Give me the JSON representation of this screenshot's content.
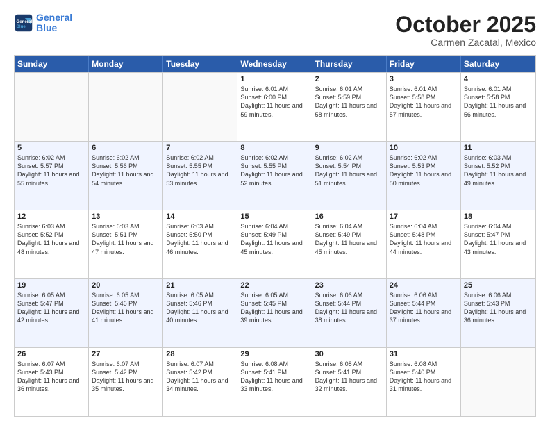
{
  "logo": {
    "line1": "General",
    "line2": "Blue"
  },
  "title": "October 2025",
  "subtitle": "Carmen Zacatal, Mexico",
  "days_of_week": [
    "Sunday",
    "Monday",
    "Tuesday",
    "Wednesday",
    "Thursday",
    "Friday",
    "Saturday"
  ],
  "weeks": [
    [
      {
        "day": "",
        "sunrise": "",
        "sunset": "",
        "daylight": "",
        "empty": true
      },
      {
        "day": "",
        "sunrise": "",
        "sunset": "",
        "daylight": "",
        "empty": true
      },
      {
        "day": "",
        "sunrise": "",
        "sunset": "",
        "daylight": "",
        "empty": true
      },
      {
        "day": "1",
        "sunrise": "Sunrise: 6:01 AM",
        "sunset": "Sunset: 6:00 PM",
        "daylight": "Daylight: 11 hours and 59 minutes."
      },
      {
        "day": "2",
        "sunrise": "Sunrise: 6:01 AM",
        "sunset": "Sunset: 5:59 PM",
        "daylight": "Daylight: 11 hours and 58 minutes."
      },
      {
        "day": "3",
        "sunrise": "Sunrise: 6:01 AM",
        "sunset": "Sunset: 5:58 PM",
        "daylight": "Daylight: 11 hours and 57 minutes."
      },
      {
        "day": "4",
        "sunrise": "Sunrise: 6:01 AM",
        "sunset": "Sunset: 5:58 PM",
        "daylight": "Daylight: 11 hours and 56 minutes."
      }
    ],
    [
      {
        "day": "5",
        "sunrise": "Sunrise: 6:02 AM",
        "sunset": "Sunset: 5:57 PM",
        "daylight": "Daylight: 11 hours and 55 minutes."
      },
      {
        "day": "6",
        "sunrise": "Sunrise: 6:02 AM",
        "sunset": "Sunset: 5:56 PM",
        "daylight": "Daylight: 11 hours and 54 minutes."
      },
      {
        "day": "7",
        "sunrise": "Sunrise: 6:02 AM",
        "sunset": "Sunset: 5:55 PM",
        "daylight": "Daylight: 11 hours and 53 minutes."
      },
      {
        "day": "8",
        "sunrise": "Sunrise: 6:02 AM",
        "sunset": "Sunset: 5:55 PM",
        "daylight": "Daylight: 11 hours and 52 minutes."
      },
      {
        "day": "9",
        "sunrise": "Sunrise: 6:02 AM",
        "sunset": "Sunset: 5:54 PM",
        "daylight": "Daylight: 11 hours and 51 minutes."
      },
      {
        "day": "10",
        "sunrise": "Sunrise: 6:02 AM",
        "sunset": "Sunset: 5:53 PM",
        "daylight": "Daylight: 11 hours and 50 minutes."
      },
      {
        "day": "11",
        "sunrise": "Sunrise: 6:03 AM",
        "sunset": "Sunset: 5:52 PM",
        "daylight": "Daylight: 11 hours and 49 minutes."
      }
    ],
    [
      {
        "day": "12",
        "sunrise": "Sunrise: 6:03 AM",
        "sunset": "Sunset: 5:52 PM",
        "daylight": "Daylight: 11 hours and 48 minutes."
      },
      {
        "day": "13",
        "sunrise": "Sunrise: 6:03 AM",
        "sunset": "Sunset: 5:51 PM",
        "daylight": "Daylight: 11 hours and 47 minutes."
      },
      {
        "day": "14",
        "sunrise": "Sunrise: 6:03 AM",
        "sunset": "Sunset: 5:50 PM",
        "daylight": "Daylight: 11 hours and 46 minutes."
      },
      {
        "day": "15",
        "sunrise": "Sunrise: 6:04 AM",
        "sunset": "Sunset: 5:49 PM",
        "daylight": "Daylight: 11 hours and 45 minutes."
      },
      {
        "day": "16",
        "sunrise": "Sunrise: 6:04 AM",
        "sunset": "Sunset: 5:49 PM",
        "daylight": "Daylight: 11 hours and 45 minutes."
      },
      {
        "day": "17",
        "sunrise": "Sunrise: 6:04 AM",
        "sunset": "Sunset: 5:48 PM",
        "daylight": "Daylight: 11 hours and 44 minutes."
      },
      {
        "day": "18",
        "sunrise": "Sunrise: 6:04 AM",
        "sunset": "Sunset: 5:47 PM",
        "daylight": "Daylight: 11 hours and 43 minutes."
      }
    ],
    [
      {
        "day": "19",
        "sunrise": "Sunrise: 6:05 AM",
        "sunset": "Sunset: 5:47 PM",
        "daylight": "Daylight: 11 hours and 42 minutes."
      },
      {
        "day": "20",
        "sunrise": "Sunrise: 6:05 AM",
        "sunset": "Sunset: 5:46 PM",
        "daylight": "Daylight: 11 hours and 41 minutes."
      },
      {
        "day": "21",
        "sunrise": "Sunrise: 6:05 AM",
        "sunset": "Sunset: 5:46 PM",
        "daylight": "Daylight: 11 hours and 40 minutes."
      },
      {
        "day": "22",
        "sunrise": "Sunrise: 6:05 AM",
        "sunset": "Sunset: 5:45 PM",
        "daylight": "Daylight: 11 hours and 39 minutes."
      },
      {
        "day": "23",
        "sunrise": "Sunrise: 6:06 AM",
        "sunset": "Sunset: 5:44 PM",
        "daylight": "Daylight: 11 hours and 38 minutes."
      },
      {
        "day": "24",
        "sunrise": "Sunrise: 6:06 AM",
        "sunset": "Sunset: 5:44 PM",
        "daylight": "Daylight: 11 hours and 37 minutes."
      },
      {
        "day": "25",
        "sunrise": "Sunrise: 6:06 AM",
        "sunset": "Sunset: 5:43 PM",
        "daylight": "Daylight: 11 hours and 36 minutes."
      }
    ],
    [
      {
        "day": "26",
        "sunrise": "Sunrise: 6:07 AM",
        "sunset": "Sunset: 5:43 PM",
        "daylight": "Daylight: 11 hours and 36 minutes."
      },
      {
        "day": "27",
        "sunrise": "Sunrise: 6:07 AM",
        "sunset": "Sunset: 5:42 PM",
        "daylight": "Daylight: 11 hours and 35 minutes."
      },
      {
        "day": "28",
        "sunrise": "Sunrise: 6:07 AM",
        "sunset": "Sunset: 5:42 PM",
        "daylight": "Daylight: 11 hours and 34 minutes."
      },
      {
        "day": "29",
        "sunrise": "Sunrise: 6:08 AM",
        "sunset": "Sunset: 5:41 PM",
        "daylight": "Daylight: 11 hours and 33 minutes."
      },
      {
        "day": "30",
        "sunrise": "Sunrise: 6:08 AM",
        "sunset": "Sunset: 5:41 PM",
        "daylight": "Daylight: 11 hours and 32 minutes."
      },
      {
        "day": "31",
        "sunrise": "Sunrise: 6:08 AM",
        "sunset": "Sunset: 5:40 PM",
        "daylight": "Daylight: 11 hours and 31 minutes."
      },
      {
        "day": "",
        "sunrise": "",
        "sunset": "",
        "daylight": "",
        "empty": true
      }
    ]
  ]
}
